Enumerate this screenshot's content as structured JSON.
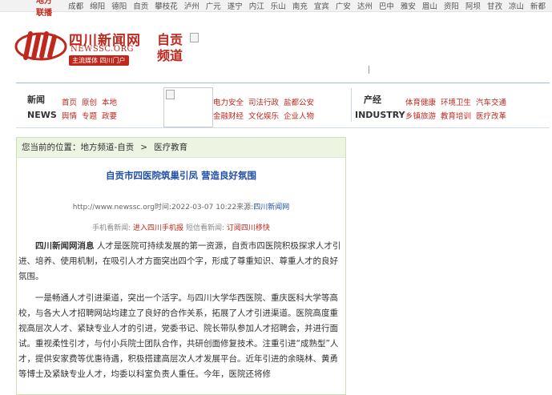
{
  "citybar": {
    "title": "地方联播",
    "cities": [
      "成都",
      "绵阳",
      "德阳",
      "自贡",
      "攀枝花",
      "泸州",
      "广元",
      "遂宁",
      "内江",
      "乐山",
      "南充",
      "宜宾",
      "广安",
      "达州",
      "巴中",
      "雅安",
      "眉山",
      "资阳",
      "阿坝",
      "甘孜",
      "凉山",
      "新都"
    ]
  },
  "header": {
    "logo_cn": "四川新闻网",
    "logo_en": "NEWSSC.ORG",
    "slogan": "主流媒体 四川门户",
    "channel_line1": "自贡",
    "channel_line2": "频道"
  },
  "nav": {
    "news_cn": "新闻",
    "news_en": "NEWS",
    "news_row1": [
      "首页",
      "原创",
      "本地"
    ],
    "news_row2": [
      "舆情",
      "专题",
      "政要"
    ],
    "mid_row1": [
      "电力安全",
      "司法行政",
      "盐都公安"
    ],
    "mid_row2": [
      "金融财经",
      "文化娱乐",
      "企业人物"
    ],
    "industry_cn": "产经",
    "industry_en": "INDUSTRY",
    "ind_row1": [
      "体育健康",
      "环境卫生",
      "汽车交通"
    ],
    "ind_row2": [
      "乡镇旅游",
      "教育培训",
      "医疗改革"
    ]
  },
  "article": {
    "crumb_prefix": "您当前的位置：",
    "crumb_1": "地方频道-自贡",
    "crumb_sep": ">",
    "crumb_2": "医疗教育",
    "title": "自贡市四医院筑巢引凤 营造良好氛围",
    "meta_url": "http://www.newssc.org",
    "meta_time": "时间:2022-03-07 10:22",
    "meta_src_label": "来源:",
    "meta_src": "四川新闻网",
    "mobile_label": "手机看新闻:",
    "mobile_link": "进入四川手机报",
    "sms_label": "短信看新闻:",
    "sms_link": "订阅四川移快",
    "lead": "四川新闻网消息",
    "p1": " 人才是医院可持续发展的第一资源，自贡市四医院积极探求人才引进、培养、使用机制，在吸引人才方面突出四个字，形成了尊重知识、尊重人才的良好氛围。",
    "p2": "一是畅通人才引进渠道，突出一个活字。与四川大学华西医院、重庆医科大学等高校，与各大人才招聘网站均建立了良好的合作关系，拓展了人才引进渠道。医院高度重视高层次人才、紧缺专业人才的引进，党委书记、院长带队参加人才招聘会，并进行面试。重视柔性引才，与付小兵院士团队合作，共研创面修复技术。注重引进“成熟型”人才，提供安家费等优惠待遇，积极搭建高层次人才发展平台。近年引进的余晓林、黄勇等博士及紧缺专业人才，均委以科室负责人重任。今年，医院还将修"
  }
}
